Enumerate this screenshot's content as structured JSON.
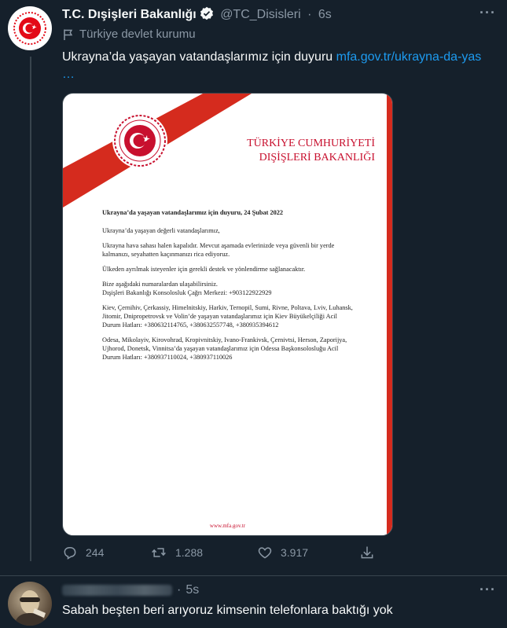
{
  "tweet": {
    "display_name": "T.C. Dışişleri Bakanlığı",
    "handle": "@TC_Disisleri",
    "separator": "·",
    "time": "6s",
    "label": "Türkiye devlet kurumu",
    "text": "Ukrayna’da yaşayan vatandaşlarımız için duyuru ",
    "link": "mfa.gov.tr/ukrayna-da-yas",
    "link_cont": "…",
    "more": "···"
  },
  "document": {
    "title_line1": "TÜRKİYE CUMHURİYETİ",
    "title_line2": "DIŞİŞLERİ BAKANLIĞI",
    "heading": "Ukrayna’da yaşayan vatandaşlarımız için duyuru, 24 Şubat 2022",
    "p1": "Ukrayna’da yaşayan değerli vatandaşlarımız,",
    "p2": "Ukrayna hava sahası halen kapalıdır. Mevcut aşamada evlerinizde veya güvenli bir yerde kalmanızı, seyahatten kaçınmanızı rica ediyoruz.",
    "p3": "Ülkeden ayrılmak isteyenler için gerekli destek ve yönlendirme sağlanacaktır.",
    "p4a": "Bize aşağıdaki numaralardan ulaşabilirsiniz.",
    "p4b": "Dışişleri Bakanlığı Konsolosluk Çağrı Merkezi: +903122922929",
    "p5": "Kiev, Çernihiv, Çerkassiy, Himelnitskiy, Harkiv, Ternopil, Sumi, Rivne, Poltava, Lviv, Luhansk, Jitomir, Dnipropetrovsk ve Volin’de yaşayan vatandaşlarımız için Kiev Büyükelçiliği Acil Durum Hatları: +380632114765, +380632557748, +380935394612",
    "p6": "Odesa, Mikolayiv, Kirovohrad, Kropivnitskiy, Ivano-Frankivsk, Çernivtsi, Herson, Zaporijya, Ujhorod, Donetsk, Vinnitsa’da yaşayan vatandaşlarımız için Odessa Başkonsolosluğu Acil Durum Hatları: +380937110024, +380937110026",
    "footer": "www.mfa.gov.tr"
  },
  "actions": {
    "replies": "244",
    "retweets": "1.288",
    "likes": "3.917"
  },
  "reply": {
    "separator": "·",
    "time": "5s",
    "text": "Sabah beşten beri arıyoruz kimsenin telefonlara baktığı yok",
    "more": "···"
  },
  "colors": {
    "background": "#15202b",
    "accent": "#1d9bf0",
    "muted": "#8b98a5",
    "brand_red": "#d52b1e"
  }
}
